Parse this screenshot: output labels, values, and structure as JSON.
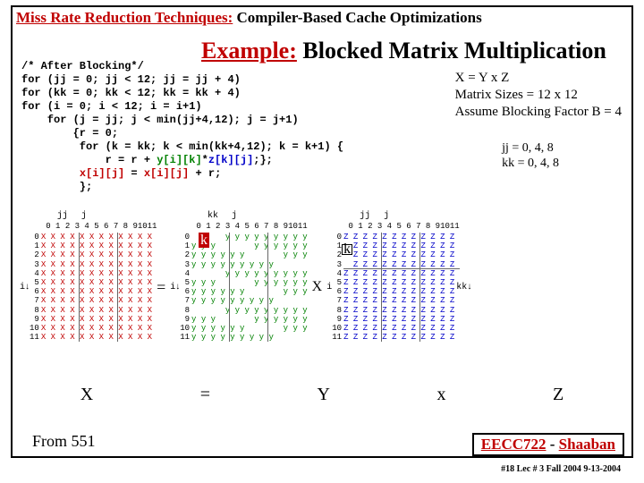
{
  "header": {
    "underlined": "Miss Rate Reduction Techniques:",
    "rest": " Compiler-Based Cache Optimizations"
  },
  "example": {
    "ex": "Example:",
    "rest": " Blocked Matrix Multiplication"
  },
  "code": {
    "l1": "/* After Blocking*/",
    "l2": "for (jj = 0; jj < 12; jj = jj + 4)",
    "l3": "for (kk = 0; kk < 12; kk = kk + 4)",
    "l4": "for (i = 0; i < 12; i = i+1)",
    "l5": "    for (j = jj; j < min(jj+4,12); j = j+1)",
    "l6": "        {r = 0;",
    "l7": "         for (k = kk; k < min(kk+4,12); k = k+1) {",
    "l8a": "             r = r + ",
    "l8y": "y[i][k]",
    "l8m": "*",
    "l8z": "z[k][j]",
    "l8e": ";};",
    "l9a": "         ",
    "l9x": "x[i][j]",
    "l9b": " = ",
    "l9x2": "x[i][j]",
    "l9c": " + r;",
    "l10": "         };"
  },
  "eqns": {
    "l1": "X  = Y x  Z",
    "l2": "Matrix Sizes = 12 x 12",
    "l3": "Assume Blocking Factor B = 4"
  },
  "idx": {
    "l1": "jj  = 0, 4, 8",
    "l2": "kk = 0, 4, 8"
  },
  "mat": {
    "cols": " 0 1 2 3 4 5 6 7 8 91011",
    "rows": " 0\n 1\n 2\n 3\n 4\n 5\n 6\n 7\n 8\n 9\n10\n11",
    "X": "X X X X X X X X X X X X\nX X X X X X X X X X X X\nX X X X X X X X X X X X\nX X X X X X X X X X X X\nX X X X X X X X X X X X\nX X X X X X X X X X X X\nX X X X X X X X X X X X\nX X X X X X X X X X X X\nX X X X X X X X X X X X\nX X X X X X X X X X X X\nX X X X X X X X X X X X\nX X X X X X X X X X X X",
    "Y": "       y y y y y y y y y\ny y y        y y y y y y\ny y y y y y        y y y\ny y y y y y y y y       \n       y y y y y y y y y\ny y y        y y y y y y\ny y y y y y        y y y\ny y y y y y y y y       \n       y y y y y y y y y\ny y y        y y y y y y\ny y y y y y        y y y\ny y y y y y y y y       ",
    "Z": "Z Z Z Z Z Z Z Z Z Z Z Z\n  Z Z Z Z Z Z Z Z Z Z Z\n  Z Z Z Z Z Z Z Z Z Z Z\n  Z Z Z Z Z Z Z Z Z Z Z\nZ Z Z Z Z Z Z Z Z Z Z Z\nZ Z Z Z Z Z Z Z Z Z Z Z\nZ Z Z Z Z Z Z Z Z Z Z Z\nZ Z Z Z Z Z Z Z Z Z Z Z\nZ Z Z Z Z Z Z Z Z Z Z Z\nZ Z Z Z Z Z Z Z Z Z Z Z\nZ Z Z Z Z Z Z Z Z Z Z Z\nZ Z Z Z Z Z Z Z Z Z Z Z",
    "jj": "jj",
    "j": "j",
    "kk": "kk",
    "i": "i",
    "k": "k",
    "eq": "=",
    "x": "x",
    "Xname": "X",
    "Yname": "Y",
    "Zname": "Z"
  },
  "from": "From 551",
  "footer": {
    "course": "EECC722",
    "sep": " - ",
    "name": "Shaaban"
  },
  "meta": "#18   Lec # 3  Fall 2004  9-13-2004"
}
